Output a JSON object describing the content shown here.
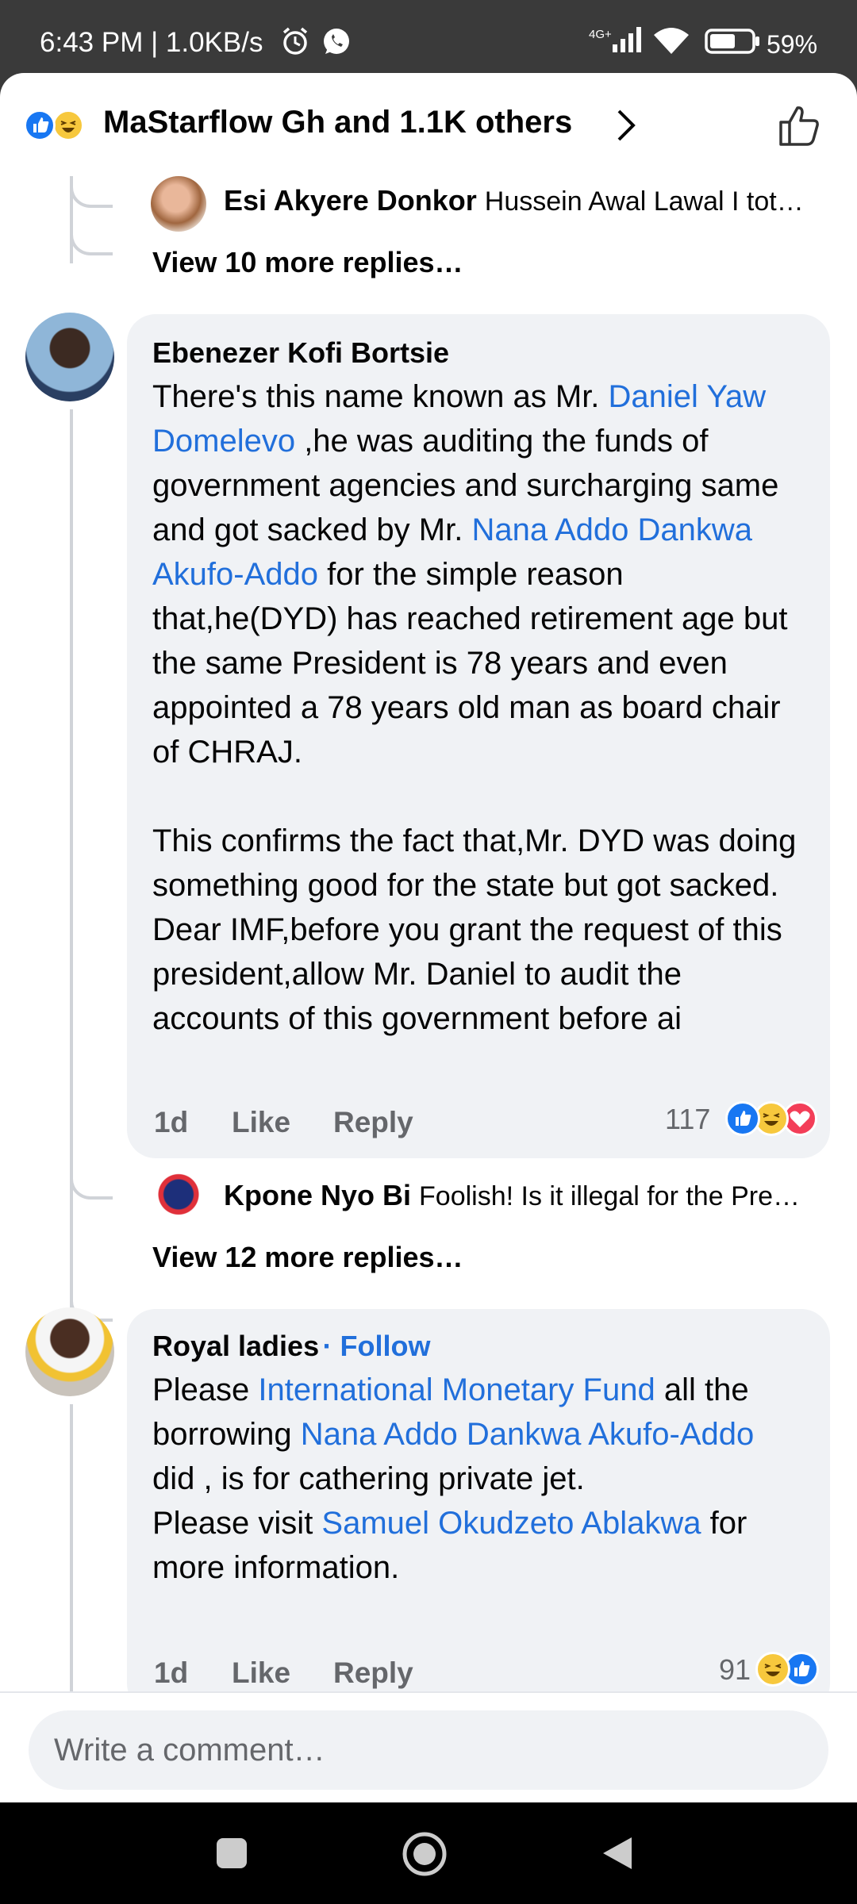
{
  "status_bar": {
    "time": "6:43 PM | 1.0KB/s",
    "network": "4G+",
    "battery": "59%"
  },
  "header": {
    "reactions_summary": "MaStarflow Gh and 1.1K others"
  },
  "thread1": {
    "reply_author": "Esi Akyere Donkor",
    "reply_text": "Hussein Awal Lawal I tot…",
    "more_replies": "View 10 more replies…"
  },
  "comment1": {
    "author": "Ebenezer Kofi Bortsie",
    "p1_a": "There's this name known as Mr. ",
    "p1_mention1": "Daniel Yaw Domelevo",
    "p1_b": " ,he was auditing the funds of government agencies and surcharging same and got sacked by Mr. ",
    "p1_mention2": "Nana Addo Dankwa Akufo-Addo",
    "p1_c": " for the simple reason that,he(DYD) has reached retirement age but the same President is 78 years and even appointed a 78 years old man as board chair of CHRAJ.",
    "p2": "This confirms the fact that,Mr. DYD was doing something good for the state but got sacked. Dear IMF,before you grant the request of this president,allow Mr. Daniel to audit the accounts of this government before ai",
    "time": "1d",
    "like": "Like",
    "reply": "Reply",
    "reaction_count": "117",
    "reply_author": "Kpone Nyo Bi",
    "reply_text": "Foolish! Is it illegal for the Pre…",
    "more_replies": "View 12 more replies…"
  },
  "comment2": {
    "author": "Royal ladies",
    "follow": "· Follow",
    "a": "Please ",
    "mention1": "International Monetary Fund",
    "b": "  all the borrowing ",
    "mention2": "Nana Addo Dankwa Akufo-Addo",
    "c": " did , is for cathering private jet.",
    "d": "Please visit ",
    "mention3": "Samuel Okudzeto Ablakwa",
    "e": " for more information.",
    "time": "1d",
    "like": "Like",
    "reply": "Reply",
    "reaction_count": "91"
  },
  "composer": {
    "placeholder": "Write a comment…"
  },
  "colors": {
    "accent": "#216fdb",
    "like_blue": "#1877f2",
    "haha_yellow": "#f7c83d",
    "love_red": "#f33e58",
    "bubble": "#f0f2f5"
  },
  "icons": [
    "alarm-icon",
    "whatsapp-icon",
    "signal-icon",
    "wifi-icon",
    "battery-icon",
    "like-reaction-icon",
    "haha-reaction-icon",
    "love-reaction-icon",
    "chevron-right-icon",
    "thumbs-up-icon",
    "recents-icon",
    "home-icon",
    "back-icon"
  ]
}
